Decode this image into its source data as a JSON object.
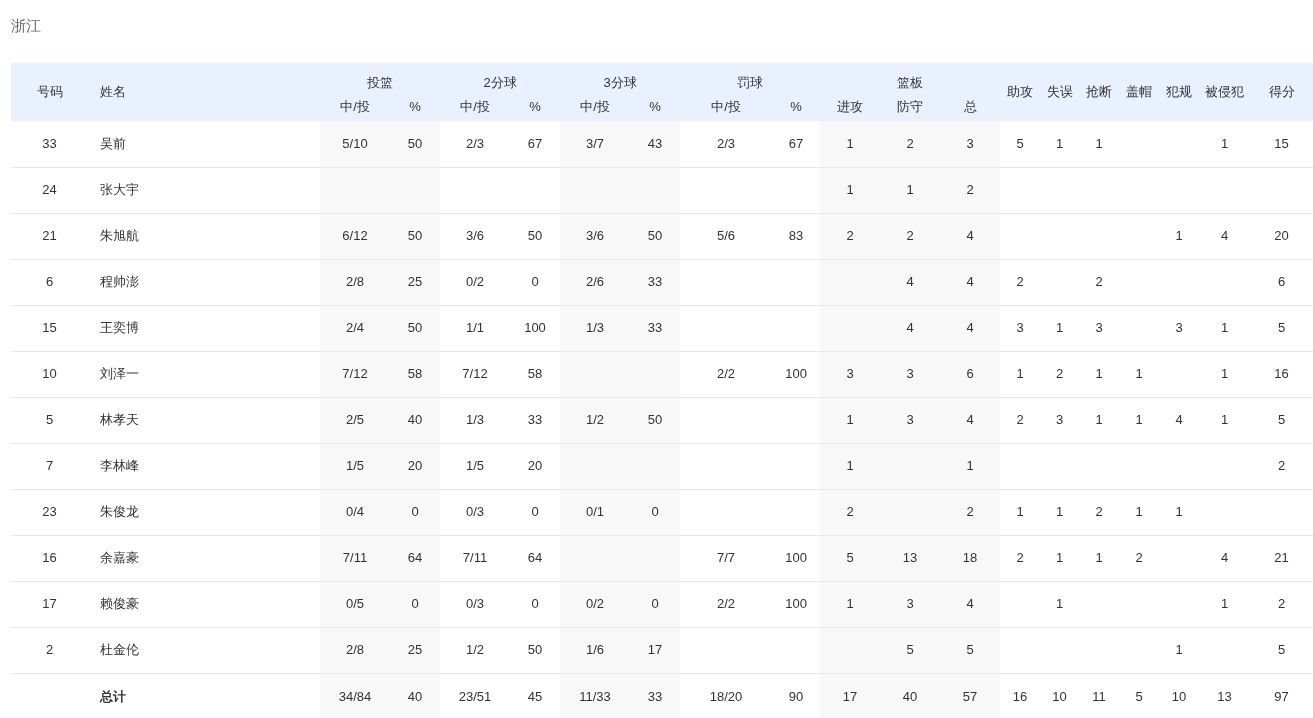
{
  "team": "浙江",
  "columns": [
    {
      "kind": "single",
      "label": "号码"
    },
    {
      "kind": "single",
      "label": "姓名"
    },
    {
      "kind": "group",
      "label": "投篮",
      "subs": [
        "中/投",
        "%"
      ]
    },
    {
      "kind": "group",
      "label": "2分球",
      "subs": [
        "中/投",
        "%"
      ]
    },
    {
      "kind": "group",
      "label": "3分球",
      "subs": [
        "中/投",
        "%"
      ]
    },
    {
      "kind": "group",
      "label": "罚球",
      "subs": [
        "中/投",
        "%"
      ]
    },
    {
      "kind": "group",
      "label": "篮板",
      "subs": [
        "进攻",
        "防守",
        "总"
      ]
    },
    {
      "kind": "single",
      "label": "助攻"
    },
    {
      "kind": "single",
      "label": "失误"
    },
    {
      "kind": "single",
      "label": "抢断"
    },
    {
      "kind": "single",
      "label": "盖帽"
    },
    {
      "kind": "single",
      "label": "犯规"
    },
    {
      "kind": "single",
      "label": "被侵犯"
    },
    {
      "kind": "single",
      "label": "得分"
    }
  ],
  "rows": [
    {
      "kind": "player",
      "number": "33",
      "name": "吴前",
      "stats": {
        "fg": "5/10",
        "fg_pct": "50",
        "two": "2/3",
        "two_pct": "67",
        "three": "3/7",
        "three_pct": "43",
        "ft": "2/3",
        "ft_pct": "67",
        "oreb": "1",
        "dreb": "2",
        "reb": "3",
        "ast": "5",
        "tov": "1",
        "stl": "1",
        "fouled": "1",
        "pts": "15"
      }
    },
    {
      "kind": "player",
      "number": "24",
      "name": "张大宇",
      "stats": {
        "oreb": "1",
        "dreb": "1",
        "reb": "2"
      }
    },
    {
      "kind": "player",
      "number": "21",
      "name": "朱旭航",
      "stats": {
        "fg": "6/12",
        "fg_pct": "50",
        "two": "3/6",
        "two_pct": "50",
        "three": "3/6",
        "three_pct": "50",
        "ft": "5/6",
        "ft_pct": "83",
        "oreb": "2",
        "dreb": "2",
        "reb": "4",
        "pf": "1",
        "fouled": "4",
        "pts": "20"
      }
    },
    {
      "kind": "player",
      "number": "6",
      "name": "程帅澎",
      "stats": {
        "fg": "2/8",
        "fg_pct": "25",
        "two": "0/2",
        "two_pct": "0",
        "three": "2/6",
        "three_pct": "33",
        "dreb": "4",
        "reb": "4",
        "ast": "2",
        "stl": "2",
        "pts": "6"
      }
    },
    {
      "kind": "player",
      "number": "15",
      "name": "王奕博",
      "stats": {
        "fg": "2/4",
        "fg_pct": "50",
        "two": "1/1",
        "two_pct": "100",
        "three": "1/3",
        "three_pct": "33",
        "dreb": "4",
        "reb": "4",
        "ast": "3",
        "tov": "1",
        "stl": "3",
        "pf": "3",
        "fouled": "1",
        "pts": "5"
      }
    },
    {
      "kind": "player",
      "number": "10",
      "name": "刘泽一",
      "stats": {
        "fg": "7/12",
        "fg_pct": "58",
        "two": "7/12",
        "two_pct": "58",
        "ft": "2/2",
        "ft_pct": "100",
        "oreb": "3",
        "dreb": "3",
        "reb": "6",
        "ast": "1",
        "tov": "2",
        "stl": "1",
        "blk": "1",
        "fouled": "1",
        "pts": "16"
      }
    },
    {
      "kind": "player",
      "number": "5",
      "name": "林孝天",
      "stats": {
        "fg": "2/5",
        "fg_pct": "40",
        "two": "1/3",
        "two_pct": "33",
        "three": "1/2",
        "three_pct": "50",
        "oreb": "1",
        "dreb": "3",
        "reb": "4",
        "ast": "2",
        "tov": "3",
        "stl": "1",
        "blk": "1",
        "pf": "4",
        "fouled": "1",
        "pts": "5"
      }
    },
    {
      "kind": "player",
      "number": "7",
      "name": "李林峰",
      "stats": {
        "fg": "1/5",
        "fg_pct": "20",
        "two": "1/5",
        "two_pct": "20",
        "oreb": "1",
        "reb": "1",
        "pts": "2"
      }
    },
    {
      "kind": "player",
      "number": "23",
      "name": "朱俊龙",
      "stats": {
        "fg": "0/4",
        "fg_pct": "0",
        "two": "0/3",
        "two_pct": "0",
        "three": "0/1",
        "three_pct": "0",
        "oreb": "2",
        "reb": "2",
        "ast": "1",
        "tov": "1",
        "stl": "2",
        "blk": "1",
        "pf": "1"
      }
    },
    {
      "kind": "player",
      "number": "16",
      "name": "余嘉豪",
      "stats": {
        "fg": "7/11",
        "fg_pct": "64",
        "two": "7/11",
        "two_pct": "64",
        "ft": "7/7",
        "ft_pct": "100",
        "oreb": "5",
        "dreb": "13",
        "reb": "18",
        "ast": "2",
        "tov": "1",
        "stl": "1",
        "blk": "2",
        "fouled": "4",
        "pts": "21"
      }
    },
    {
      "kind": "player",
      "number": "17",
      "name": "赖俊豪",
      "stats": {
        "fg": "0/5",
        "fg_pct": "0",
        "two": "0/3",
        "two_pct": "0",
        "three": "0/2",
        "three_pct": "0",
        "ft": "2/2",
        "ft_pct": "100",
        "oreb": "1",
        "dreb": "3",
        "reb": "4",
        "tov": "1",
        "fouled": "1",
        "pts": "2"
      }
    },
    {
      "kind": "player",
      "number": "2",
      "name": "杜金伦",
      "stats": {
        "fg": "2/8",
        "fg_pct": "25",
        "two": "1/2",
        "two_pct": "50",
        "three": "1/6",
        "three_pct": "17",
        "dreb": "5",
        "reb": "5",
        "pf": "1",
        "pts": "5"
      }
    },
    {
      "kind": "total",
      "name": "总计",
      "stats": {
        "fg": "34/84",
        "fg_pct": "40",
        "two": "23/51",
        "two_pct": "45",
        "three": "11/33",
        "three_pct": "33",
        "ft": "18/20",
        "ft_pct": "90",
        "oreb": "17",
        "dreb": "40",
        "reb": "57",
        "ast": "16",
        "tov": "10",
        "stl": "11",
        "blk": "5",
        "pf": "10",
        "fouled": "13",
        "pts": "97"
      }
    }
  ]
}
